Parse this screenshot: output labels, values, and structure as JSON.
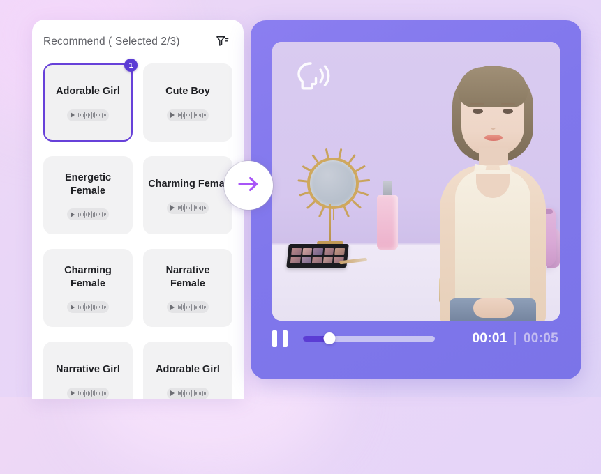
{
  "theme": {
    "accent": "#6741d9",
    "badge_bg": "#5b3cd4",
    "player_bg": "#7f77ec",
    "page_bg": "#e7d5f7",
    "card_bg": "#f2f2f3"
  },
  "recommend_panel": {
    "title": "Recommend ( Selected 2/3)",
    "filter_icon": "filter-icon",
    "voices": [
      {
        "name": "Adorable Girl",
        "selected": true,
        "badge": "1",
        "play_icon": "play-icon",
        "waveform_icon": "waveform-icon"
      },
      {
        "name": "Cute Boy",
        "selected": false,
        "badge": "",
        "play_icon": "play-icon",
        "waveform_icon": "waveform-icon"
      },
      {
        "name": "Energetic Female",
        "selected": false,
        "badge": "",
        "play_icon": "play-icon",
        "waveform_icon": "waveform-icon"
      },
      {
        "name": "Charming Femal",
        "selected": false,
        "badge": "",
        "play_icon": "play-icon",
        "waveform_icon": "waveform-icon"
      },
      {
        "name": "Charming Female",
        "selected": false,
        "badge": "",
        "play_icon": "play-icon",
        "waveform_icon": "waveform-icon"
      },
      {
        "name": "Narrative Female",
        "selected": false,
        "badge": "",
        "play_icon": "play-icon",
        "waveform_icon": "waveform-icon"
      },
      {
        "name": "Narrative Girl",
        "selected": false,
        "badge": "",
        "play_icon": "play-icon",
        "waveform_icon": "waveform-icon"
      },
      {
        "name": "Adorable Girl",
        "selected": false,
        "badge": "",
        "play_icon": "play-icon",
        "waveform_icon": "waveform-icon"
      }
    ]
  },
  "next_button": {
    "icon": "arrow-right-icon"
  },
  "video_player": {
    "overlay_icon": "speaking-head-icon",
    "controls": {
      "pause_icon": "pause-icon",
      "progress_percent": 20,
      "current_time": "00:01",
      "time_separator": "|",
      "total_time": "00:05"
    }
  }
}
